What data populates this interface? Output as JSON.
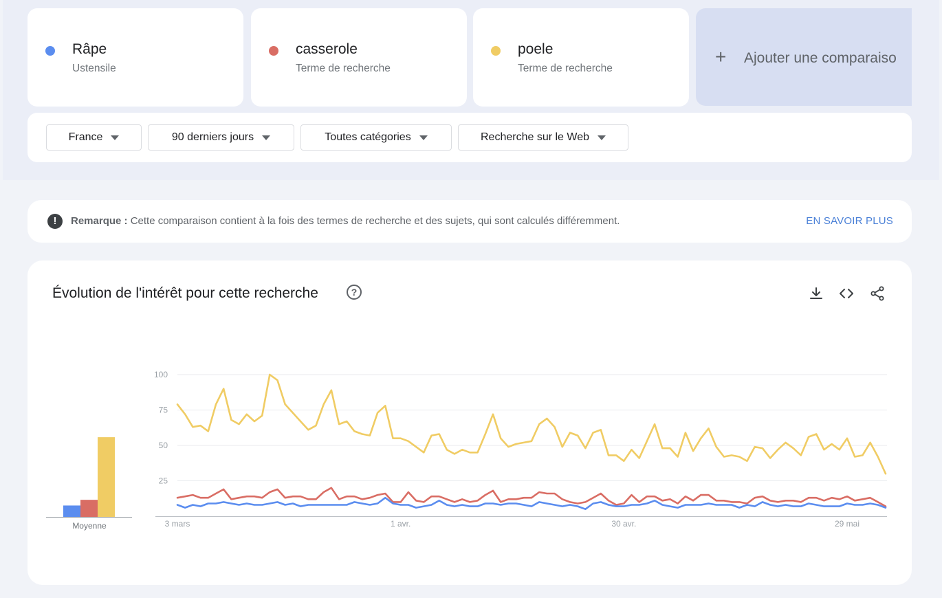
{
  "terms": [
    {
      "name": "Râpe",
      "type": "Ustensile",
      "color": "#5b8def"
    },
    {
      "name": "casserole",
      "type": "Terme de recherche",
      "color": "#d96d64"
    },
    {
      "name": "poele",
      "type": "Terme de recherche",
      "color": "#f0cc64"
    }
  ],
  "add_comparison": {
    "icon": "plus-icon",
    "label": "Ajouter une comparaiso"
  },
  "filters": [
    {
      "label": "France",
      "icon": "caret-down-icon"
    },
    {
      "label": "90 derniers jours",
      "icon": "caret-down-icon"
    },
    {
      "label": "Toutes catégories",
      "icon": "caret-down-icon"
    },
    {
      "label": "Recherche sur le Web",
      "icon": "caret-down-icon"
    }
  ],
  "note": {
    "icon": "exclamation-icon",
    "bold": "Remarque :",
    "text": " Cette comparaison contient à la fois des termes de recherche et des sujets, qui sont calculés différemment.",
    "link": "EN SAVOIR PLUS"
  },
  "chart": {
    "title": "Évolution de l'intérêt pour cette recherche",
    "help_icon": "help-icon",
    "tools": [
      "download-icon",
      "embed-icon",
      "share-icon"
    ]
  },
  "chart_data": [
    {
      "type": "bar",
      "xlabel": "Moyenne",
      "categories": [
        "Râpe",
        "casserole",
        "poele"
      ],
      "values": [
        8,
        12,
        56
      ],
      "colors": [
        "#5b8def",
        "#d96d64",
        "#f0cc64"
      ]
    },
    {
      "type": "line",
      "ylim": [
        0,
        100
      ],
      "yticks": [
        25,
        50,
        75,
        100
      ],
      "xtick_labels": [
        {
          "label": "3 mars",
          "index": 0
        },
        {
          "label": "1 avr.",
          "index": 29
        },
        {
          "label": "30 avr.",
          "index": 58
        },
        {
          "label": "29 mai",
          "index": 87
        }
      ],
      "grid": true,
      "series": [
        {
          "name": "poele",
          "color": "#f0cc64",
          "values": [
            79,
            72,
            63,
            64,
            60,
            79,
            90,
            68,
            65,
            72,
            67,
            71,
            100,
            96,
            79,
            73,
            67,
            61,
            64,
            79,
            89,
            65,
            67,
            60,
            58,
            57,
            73,
            78,
            55,
            55,
            53,
            49,
            45,
            57,
            58,
            47,
            44,
            47,
            45,
            45,
            58,
            72,
            55,
            49,
            51,
            52,
            53,
            65,
            69,
            63,
            49,
            59,
            57,
            48,
            59,
            61,
            43,
            43,
            39,
            47,
            41,
            53,
            65,
            48,
            48,
            42,
            59,
            46,
            55,
            62,
            49,
            42,
            43,
            42,
            39,
            49,
            48,
            41,
            47,
            52,
            48,
            43,
            56,
            58,
            47,
            51,
            47,
            55,
            42,
            43,
            52,
            42,
            30
          ]
        },
        {
          "name": "casserole",
          "color": "#d96d64",
          "values": [
            13,
            14,
            15,
            13,
            13,
            16,
            19,
            12,
            13,
            14,
            14,
            13,
            17,
            19,
            13,
            14,
            14,
            12,
            12,
            17,
            20,
            12,
            14,
            14,
            12,
            13,
            15,
            16,
            10,
            10,
            17,
            11,
            10,
            14,
            14,
            12,
            10,
            12,
            10,
            11,
            15,
            18,
            10,
            12,
            12,
            13,
            13,
            17,
            16,
            16,
            12,
            10,
            9,
            10,
            13,
            16,
            11,
            8,
            9,
            15,
            10,
            14,
            14,
            11,
            12,
            9,
            14,
            11,
            15,
            15,
            11,
            11,
            10,
            10,
            9,
            13,
            14,
            11,
            10,
            11,
            11,
            10,
            13,
            13,
            11,
            13,
            12,
            14,
            11,
            12,
            13,
            10,
            7
          ]
        },
        {
          "name": "Râpe",
          "color": "#5b8def",
          "values": [
            8,
            6,
            8,
            7,
            9,
            9,
            10,
            9,
            8,
            9,
            8,
            8,
            9,
            10,
            8,
            9,
            7,
            8,
            8,
            8,
            8,
            8,
            8,
            10,
            9,
            8,
            9,
            13,
            9,
            8,
            8,
            6,
            7,
            8,
            11,
            8,
            7,
            8,
            7,
            7,
            9,
            9,
            8,
            9,
            9,
            8,
            7,
            10,
            9,
            8,
            7,
            8,
            7,
            5,
            9,
            10,
            8,
            7,
            7,
            8,
            8,
            9,
            11,
            8,
            7,
            6,
            8,
            8,
            8,
            9,
            8,
            8,
            8,
            6,
            8,
            7,
            10,
            8,
            7,
            8,
            7,
            7,
            9,
            8,
            7,
            7,
            7,
            9,
            8,
            8,
            9,
            8,
            6
          ]
        }
      ]
    }
  ]
}
